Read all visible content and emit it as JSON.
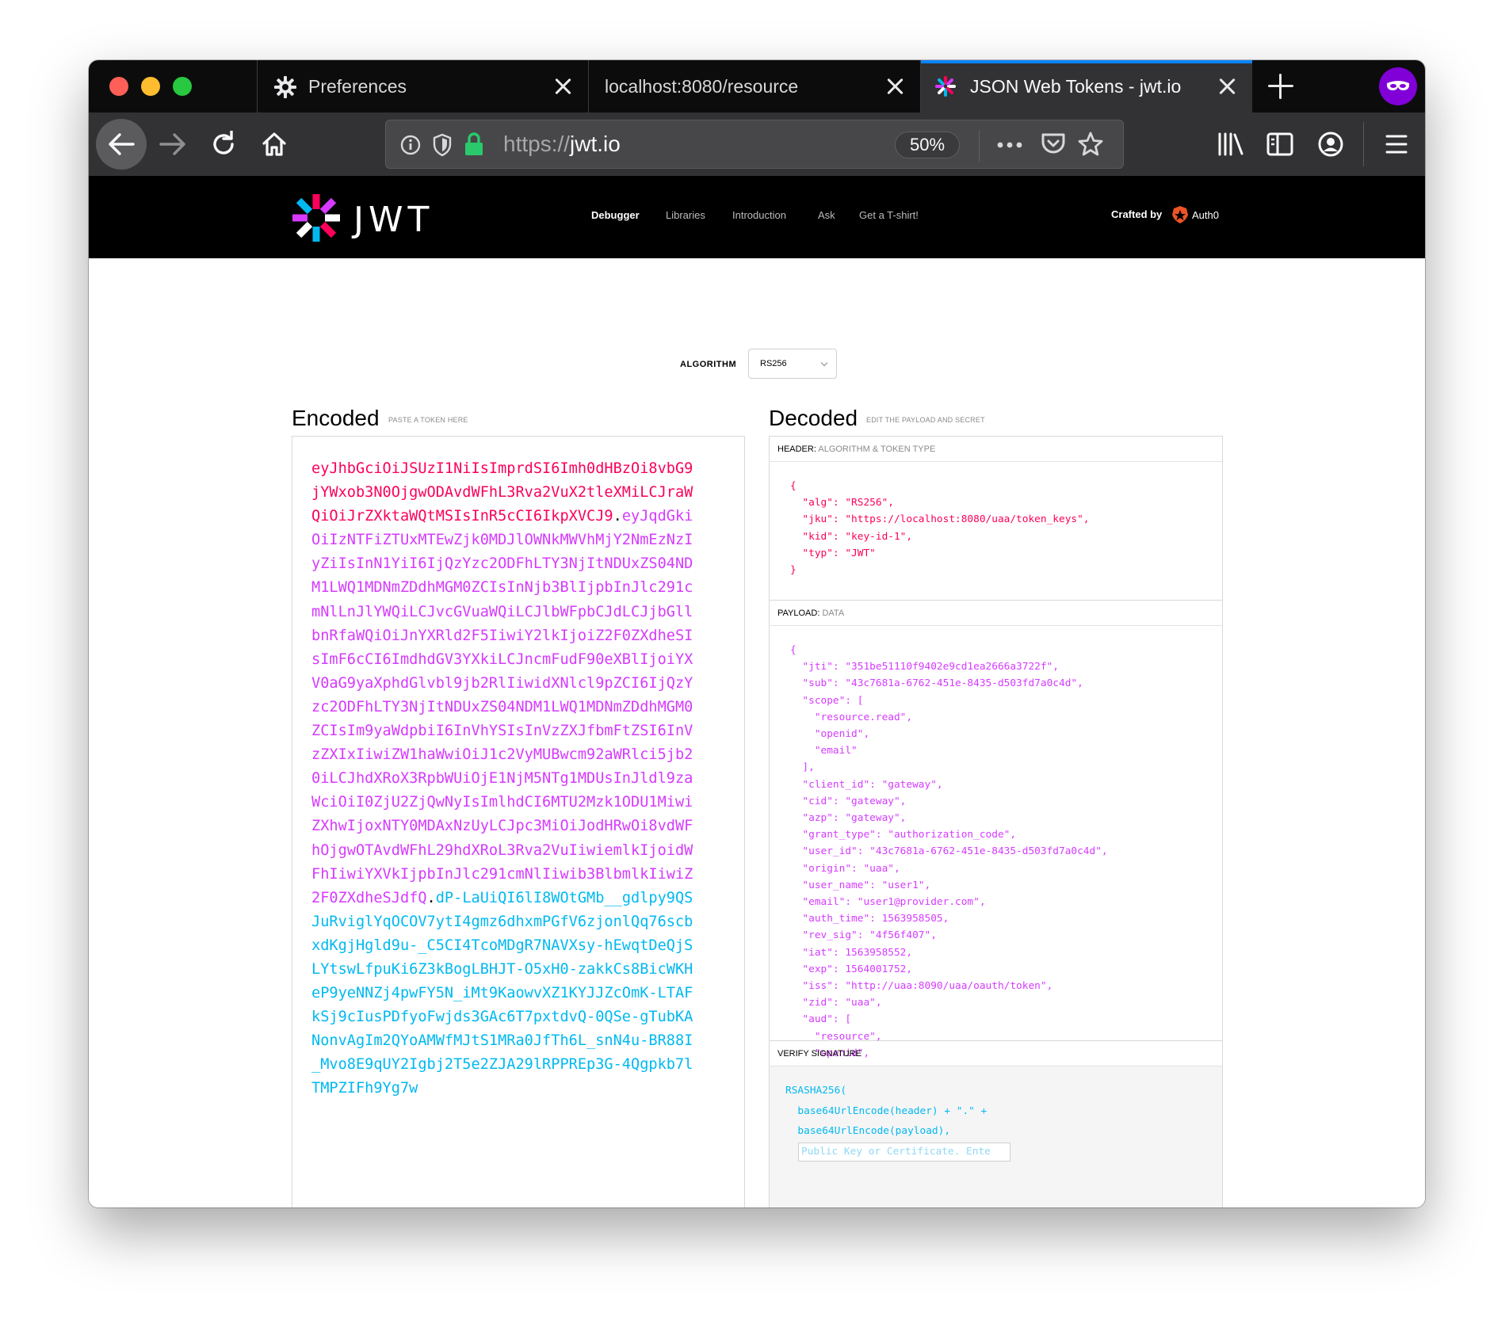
{
  "browser": {
    "tabs": [
      {
        "title": "Preferences",
        "icon": "gear-icon"
      },
      {
        "title": "localhost:8080/resource"
      },
      {
        "title": "JSON Web Tokens - jwt.io",
        "icon": "jwt-logo-icon",
        "active": true
      }
    ],
    "url": {
      "scheme": "https://",
      "host": "jwt.io"
    },
    "zoom": "50%",
    "accent_color": "#0a84ff",
    "private_color": "#8000d7"
  },
  "site": {
    "logo_text": "JWT",
    "nav": [
      "Debugger",
      "Libraries",
      "Introduction",
      "Ask",
      "Get a T-shirt!"
    ],
    "crafted_by": "Crafted by",
    "brand": "Auth0"
  },
  "algorithm": {
    "label": "ALGORITHM",
    "value": "RS256"
  },
  "encoded": {
    "title": "Encoded",
    "subtitle": "PASTE A TOKEN HERE",
    "header": "eyJhbGciOiJSUzI1NiIsImprdSI6Imh0dHBzOi8vbG9jYWxob3N0OjgwODAvdWFhL3Rva2VuX2tleXMiLCJraWQiOiJrZXktaWQtMSIsInR5cCI6IkpXVCJ9",
    "payload": "eyJqdGkiOiIzNTFiZTUxMTEwZjk0MDJlOWNkMWVhMjY2NmEzNzIyZiIsInN1YiI6IjQzYzc2ODFhLTY3NjItNDUxZS04NDM1LWQ1MDNmZDdhMGM0ZCIsInNjb3BlIjpbInJlc291cmNlLnJlYWQiLCJvcGVuaWQiLCJlbWFpbCJdLCJjbGllbnRfaWQiOiJnYXRld2F5IiwiY2lkIjoiZ2F0ZXdheSIsImF6cCI6ImdhdGV3YXkiLCJncmFudF90eXBlIjoiYXV0aG9yaXphdGlvbl9jb2RlIiwidXNlcl9pZCI6IjQzYzc2ODFhLTY3NjItNDUxZS04NDM1LWQ1MDNmZDdhMGM0ZCIsIm9yaWdpbiI6InVhYSIsInVzZXJfbmFtZSI6InVzZXIxIiwiZW1haWwiOiJ1c2VyMUBwcm92aWRlci5jb20iLCJhdXRoX3RpbWUiOjE1NjM5NTg1MDUsInJldl9zaWciOiI0ZjU2ZjQwNyIsImlhdCI6MTU2Mzk1ODU1MiwiZXhwIjoxNTY0MDAxNzUyLCJpc3MiOiJodHRwOi8vdWFhOjgwOTAvdWFhL29hdXRoL3Rva2VuIiwiemlkIjoidWFhIiwiYXVkIjpbInJlc291cmNlIiwib3BlbmlkIiwiZ2F0ZXdheSJdfQ",
    "signature": "dP-LaUiQI6lI8WOtGMb__gdlpy9QSJuRviglYqOCOV7ytI4gmz6dhxmPGfV6zjonlQq76scbxdKgjHgld9u-_C5CI4TcoMDgR7NAVXsy-hEwqtDeQjSLYtswLfpuKi6Z3kBogLBHJT-O5xH0-zakkCs8BicWKHeP9yeNNZj4pwFY5N_iMt9KaowvXZ1KYJJZcOmK-LTAFkSj9cIusPDfyoFwjds3GAc6T7pxtdvQ-0QSe-gTubKANonvAgIm2QYoAMWfMJtS1MRa0JfTh6L_snN4u-BR88I_Mvo8E9qUY2Igbj2T5e2ZJA29lRPPREp3G-4Qgpkb7lTMPZIFh9Yg7w"
  },
  "decoded": {
    "title": "Decoded",
    "subtitle": "EDIT THE PAYLOAD AND SECRET",
    "header_label": "HEADER:",
    "header_sub": "ALGORITHM & TOKEN TYPE",
    "header_json": "{\n  \"alg\": \"RS256\",\n  \"jku\": \"https://localhost:8080/uaa/token_keys\",\n  \"kid\": \"key-id-1\",\n  \"typ\": \"JWT\"\n}",
    "payload_label": "PAYLOAD:",
    "payload_sub": "DATA",
    "payload_json": "{\n  \"jti\": \"351be51110f9402e9cd1ea2666a3722f\",\n  \"sub\": \"43c7681a-6762-451e-8435-d503fd7a0c4d\",\n  \"scope\": [\n    \"resource.read\",\n    \"openid\",\n    \"email\"\n  ],\n  \"client_id\": \"gateway\",\n  \"cid\": \"gateway\",\n  \"azp\": \"gateway\",\n  \"grant_type\": \"authorization_code\",\n  \"user_id\": \"43c7681a-6762-451e-8435-d503fd7a0c4d\",\n  \"origin\": \"uaa\",\n  \"user_name\": \"user1\",\n  \"email\": \"user1@provider.com\",\n  \"auth_time\": 1563958505,\n  \"rev_sig\": \"4f56f407\",\n  \"iat\": 1563958552,\n  \"exp\": 1564001752,\n  \"iss\": \"http://uaa:8090/uaa/oauth/token\",\n  \"zid\": \"uaa\",\n  \"aud\": [\n    \"resource\",\n    \"openid\",\n    \"gateway\"\n  ]\n}",
    "verify_label": "VERIFY SIGNATURE",
    "verify_code": "RSASHA256(\n  base64UrlEncode(header) + \".\" +\n  base64UrlEncode(payload),",
    "key_placeholder": "Public Key or Certificate. Ente"
  }
}
